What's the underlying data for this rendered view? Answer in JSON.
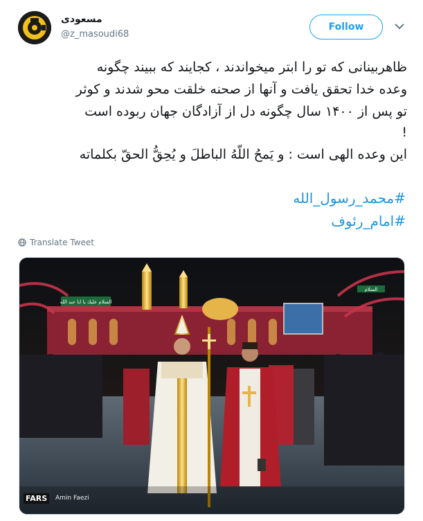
{
  "author": {
    "display_name": "مسعودی",
    "handle": "@z_masoudi68"
  },
  "follow_label": "Follow",
  "tweet": {
    "lines": [
      "ظاهربینانی که تو را ابتر میخواندند ، کجایند که ببیند چگونه",
      "وعده خدا تحقق یافت و آنها از صحنه خلقت محو شدند و کوثر",
      "تو پس از ۱۴۰۰ سال چگونه دل از آزادگان جهان ربوده است",
      "!",
      "این وعده الهی است : و یَمحُ اللّهُ الباطلَ و یُحِقُّ الحقّ بکلماته"
    ],
    "hashtags": [
      "#محمد_رسول_الله",
      "#امام_رئوف"
    ]
  },
  "translate_label": "Translate Tweet",
  "photo": {
    "credit_source": "FARS",
    "credit_name": "Amin Faezi",
    "banner_text": "السلام عليك يا ابا عبد الله",
    "side_sign_text": "السلام"
  },
  "colors": {
    "link_blue": "#1b95e0",
    "follow_blue": "#1da1f2",
    "muted_gray": "#657786"
  },
  "icons": {
    "avatar": "logo-avatar-icon",
    "caret": "chevron-down-icon",
    "translate": "globe-icon"
  }
}
